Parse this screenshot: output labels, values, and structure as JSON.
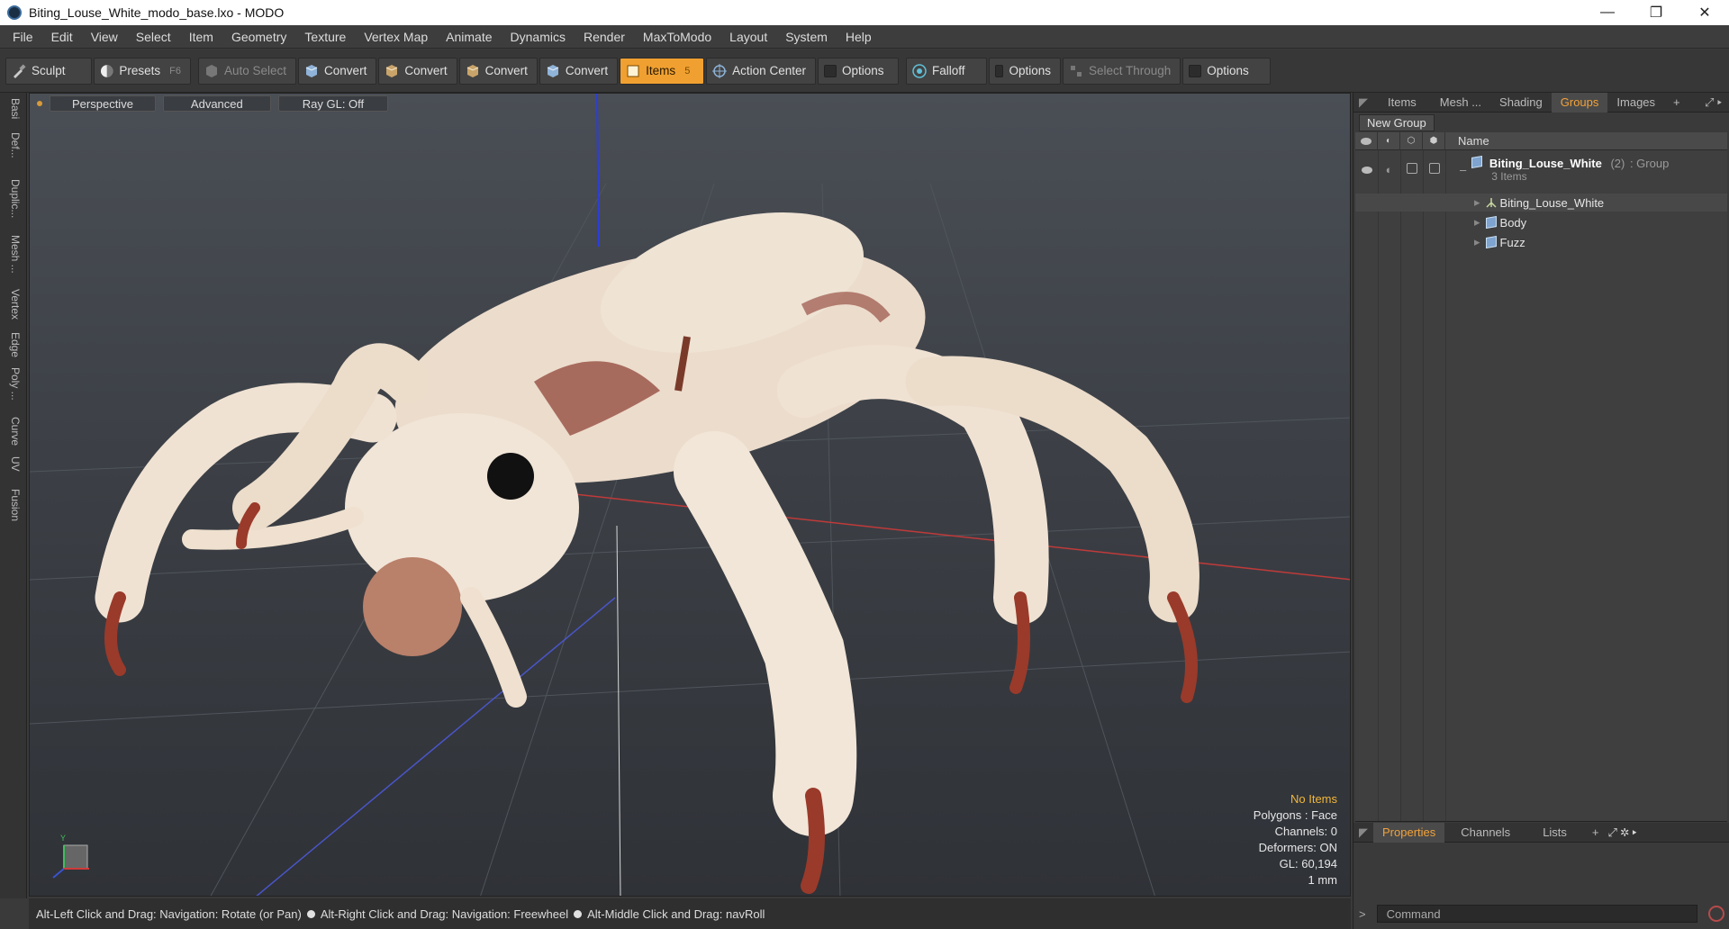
{
  "window": {
    "title": "Biting_Louse_White_modo_base.lxo - MODO",
    "minimize": "—",
    "maximize": "❐",
    "close": "✕"
  },
  "menu": [
    "File",
    "Edit",
    "View",
    "Select",
    "Item",
    "Geometry",
    "Texture",
    "Vertex Map",
    "Animate",
    "Dynamics",
    "Render",
    "MaxToModo",
    "Layout",
    "System",
    "Help"
  ],
  "toolbar": {
    "sculpt": "Sculpt",
    "presets": "Presets",
    "presets_key": "F6",
    "auto_select": "Auto Select",
    "convert1": "Convert",
    "convert2": "Convert",
    "convert3": "Convert",
    "convert4": "Convert",
    "items": "Items",
    "items_key": "5",
    "action_center": "Action Center",
    "options1": "Options",
    "falloff": "Falloff",
    "options2": "Options",
    "select_through": "Select Through",
    "options3": "Options"
  },
  "lefttabs": [
    "Basi",
    "Def...",
    "Duplic...",
    "Mesh ...",
    "Vertex",
    "Edge",
    "Poly ...",
    "Curve",
    "UV",
    "Fusion"
  ],
  "viewport": {
    "view_mode": "Perspective",
    "shading": "Advanced",
    "raygl": "Ray GL: Off",
    "stats": {
      "selection": "No Items",
      "polygons": "Polygons : Face",
      "channels": "Channels: 0",
      "deformers": "Deformers: ON",
      "gl": "GL: 60,194",
      "units": "1 mm"
    },
    "axis_y": "Y"
  },
  "statusbar": {
    "hint1": "Alt-Left Click and Drag: Navigation: Rotate (or Pan)",
    "hint2": "Alt-Right Click and Drag: Navigation: Freewheel",
    "hint3": "Alt-Middle Click and Drag: navRoll"
  },
  "rightpanel": {
    "tabs": [
      "Items",
      "Mesh ...",
      "Shading",
      "Groups",
      "Images"
    ],
    "selected_tab": "Groups",
    "add_tab": "+",
    "new_group": "New Group",
    "name_col": "Name",
    "group": {
      "name": "Biting_Louse_White",
      "count": "(2)",
      "type": ": Group",
      "sub": "3 Items"
    },
    "children": [
      "Biting_Louse_White",
      "Body",
      "Fuzz"
    ],
    "bottom_tabs": [
      "Properties",
      "Channels",
      "Lists"
    ],
    "bottom_add": "+",
    "command_placeholder": "Command",
    "command_prompt": ">"
  },
  "colors": {
    "accent": "#f0a030",
    "selected_tab_text": "#f2a23a",
    "stats_warn": "#f2b73a"
  }
}
